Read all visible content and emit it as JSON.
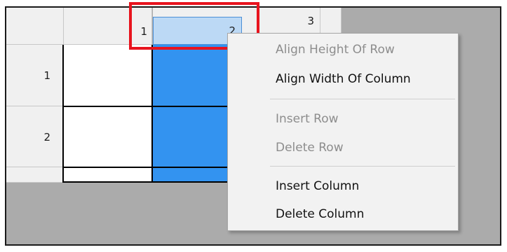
{
  "grid": {
    "column_headers": [
      "1",
      "2",
      "3"
    ],
    "row_headers": [
      "1",
      "2"
    ]
  },
  "context_menu": {
    "items": [
      {
        "label": "Align Height Of Row",
        "enabled": false
      },
      {
        "label": "Align Width Of Column",
        "enabled": true
      },
      {
        "label": "Insert Row",
        "enabled": false
      },
      {
        "label": "Delete Row",
        "enabled": false
      },
      {
        "label": "Insert Column",
        "enabled": true
      },
      {
        "label": "Delete Column",
        "enabled": true
      }
    ]
  },
  "colors": {
    "selected_cell": "#3393f0",
    "selected_header": "#bcd9f5",
    "highlight_box": "#e8141e",
    "background_area": "#ababab"
  }
}
